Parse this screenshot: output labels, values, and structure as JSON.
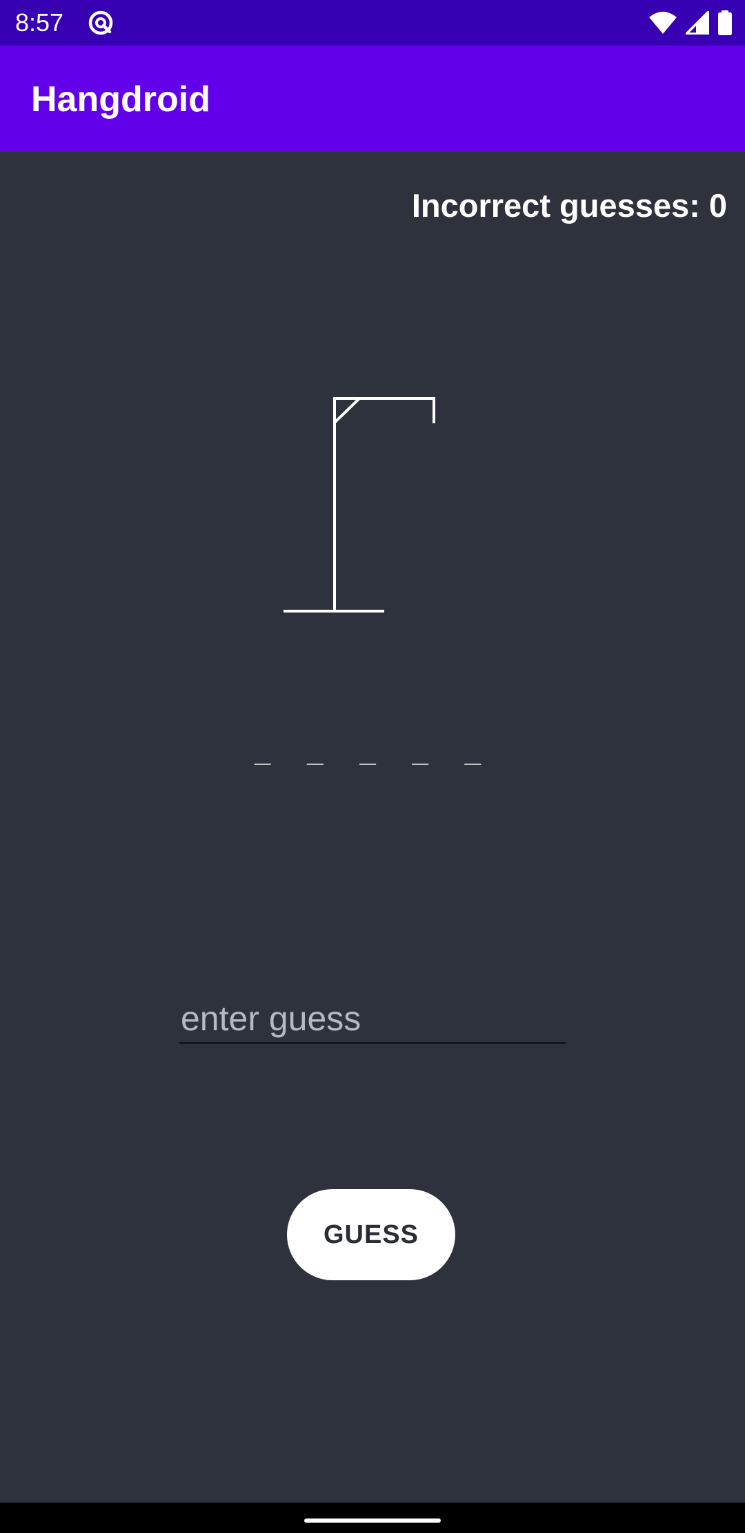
{
  "status_bar": {
    "time": "8:57",
    "icons": [
      "at-sign-icon",
      "wifi-icon",
      "signal-icon",
      "battery-icon"
    ]
  },
  "app_bar": {
    "title": "Hangdroid",
    "color": "#6200ea"
  },
  "game": {
    "incorrect_label": "Incorrect guesses:",
    "incorrect_count": "0",
    "word_display": "_ _ _ _ _",
    "input_placeholder": "enter guess",
    "input_value": "",
    "guess_button_label": "GUESS"
  },
  "colors": {
    "background": "#2e323d",
    "status_bar": "#3700b3",
    "accent": "#6200ea"
  }
}
